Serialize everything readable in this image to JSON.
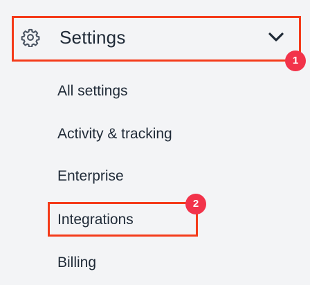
{
  "settings": {
    "title": "Settings",
    "icon": "gear-icon",
    "chevron_icon": "chevron-down-icon",
    "expanded": true
  },
  "submenu": {
    "items": [
      {
        "label": "All settings"
      },
      {
        "label": "Activity & tracking"
      },
      {
        "label": "Enterprise"
      },
      {
        "label": "Integrations"
      },
      {
        "label": "Billing"
      }
    ]
  },
  "annotations": {
    "badge_1": "1",
    "badge_2": "2",
    "highlight_color": "#f43b1a",
    "badge_color": "#f2334a"
  }
}
